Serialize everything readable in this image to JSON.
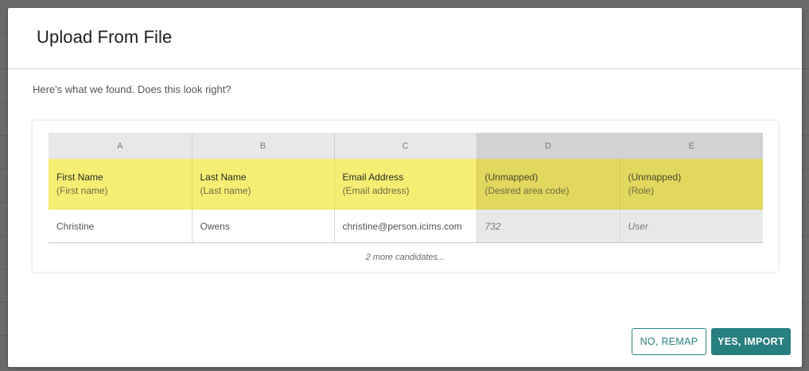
{
  "modal": {
    "title": "Upload From File",
    "subtitle": "Here's what we found. Does this look right?"
  },
  "mapping_table": {
    "columns": [
      {
        "letter": "A",
        "field": "First Name",
        "source": "(First name)",
        "sample": "Christine",
        "mapped": true
      },
      {
        "letter": "B",
        "field": "Last Name",
        "source": "(Last name)",
        "sample": "Owens",
        "mapped": true
      },
      {
        "letter": "C",
        "field": "Email Address",
        "source": "(Email address)",
        "sample": "christine@person.icims.com",
        "mapped": true
      },
      {
        "letter": "D",
        "field": "(Unmapped)",
        "source": "(Desired area code)",
        "sample": "732",
        "mapped": false
      },
      {
        "letter": "E",
        "field": "(Unmapped)",
        "source": "(Role)",
        "sample": "User",
        "mapped": false
      }
    ],
    "more_text": "2 more candidates..."
  },
  "actions": {
    "remap_label": "NO, REMAP",
    "import_label": "YES, IMPORT"
  },
  "colors": {
    "mapped_highlight": "#f6ee72",
    "unmapped_highlight": "#e1d85d",
    "primary": "#287f80"
  }
}
